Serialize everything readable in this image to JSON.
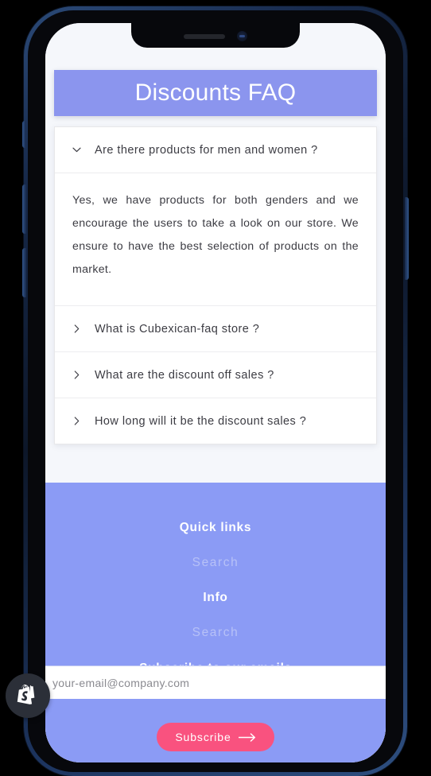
{
  "device": {
    "notch": {
      "speaker": "earpiece-speaker",
      "camera": "front-camera"
    },
    "buttons": [
      "silent-switch",
      "volume-up",
      "volume-down",
      "power"
    ]
  },
  "header": {
    "title": "Discounts FAQ",
    "background_color": "#8b95ee"
  },
  "faq": {
    "items": [
      {
        "question": "Are there products for men and women ?",
        "expanded": true,
        "chevron": "chevron-down-icon",
        "answer": "Yes, we have products for both genders and we encourage the users to take a look on our store. We ensure to have the best selection of products on the market."
      },
      {
        "question": "What is Cubexican-faq store ?",
        "expanded": false,
        "chevron": "chevron-right-icon",
        "answer": ""
      },
      {
        "question": "What are the discount off sales ?",
        "expanded": false,
        "chevron": "chevron-right-icon",
        "answer": ""
      },
      {
        "question": "How long will it be the discount sales ?",
        "expanded": false,
        "chevron": "chevron-right-icon",
        "answer": ""
      }
    ]
  },
  "footer": {
    "background_color": "#8b9bf5",
    "quick_links_heading": "Quick links",
    "quick_links_item": "Search",
    "info_heading": "Info",
    "info_item": "Search",
    "subscribe_heading": "Subscribe to our emails",
    "email_placeholder": "your-email@company.com",
    "email_value": "",
    "subscribe_button": "Subscribe",
    "subscribe_button_color": "#f9527f",
    "subscribe_arrow": "arrow-right-icon"
  },
  "badge": {
    "name": "shopify-logo-icon"
  }
}
